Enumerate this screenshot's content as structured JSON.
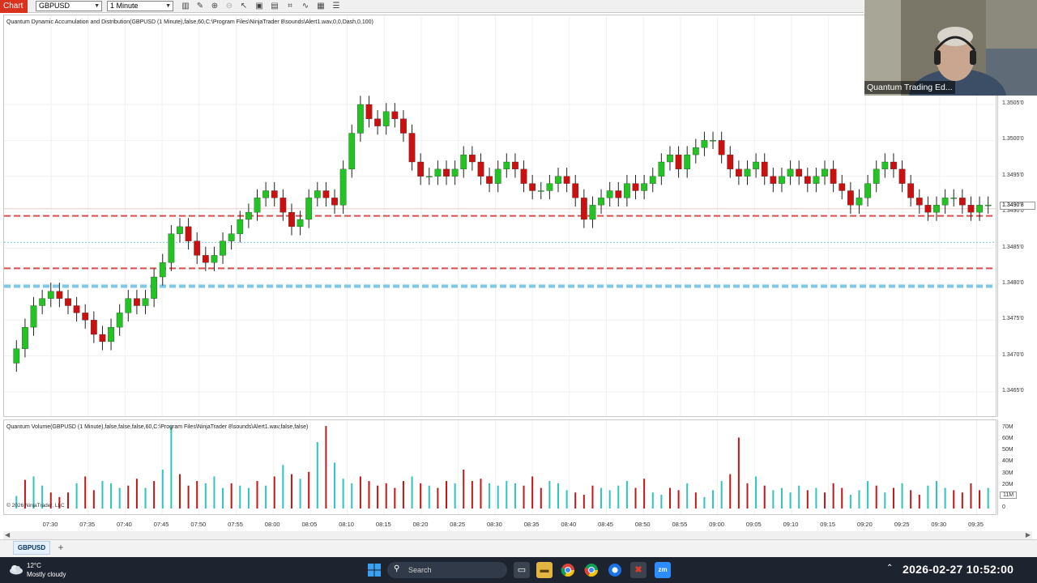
{
  "toolbar": {
    "tab_label": "Chart",
    "instrument": "GBPUSD",
    "interval": "1 Minute"
  },
  "price_pane": {
    "indicator_label": "Quantum Dynamic Accumulation and Distribution(GBPUSD (1 Minute),false,60,C:\\Program Files\\NinjaTrader 8\\sounds\\Alert1.wav,0,0,Dash,0,100)",
    "axis_ticks": [
      "1.3505'0",
      "1.3500'0",
      "1.3495'0",
      "1.3490'0",
      "1.3485'0",
      "1.3480'0",
      "1.3475'0",
      "1.3470'0",
      "1.3465'0"
    ],
    "last_price_tag": "1.3490'8"
  },
  "volume_pane": {
    "indicator_label": "Quantum Volume(GBPUSD (1 Minute),false,false,false,60,C:\\Program Files\\NinjaTrader 8\\sounds\\Alert1.wav,false,false)",
    "axis_ticks": [
      "70M",
      "60M",
      "50M",
      "40M",
      "30M",
      "20M",
      "11M",
      "0"
    ],
    "copyright": "© 2026 NinjaTrader, LLC"
  },
  "time_axis": [
    "07:30",
    "07:35",
    "07:40",
    "07:45",
    "07:50",
    "07:55",
    "08:00",
    "08:05",
    "08:10",
    "08:15",
    "08:20",
    "08:25",
    "08:30",
    "08:35",
    "08:40",
    "08:45",
    "08:50",
    "08:55",
    "09:00",
    "09:05",
    "09:10",
    "09:15",
    "09:20",
    "09:25",
    "09:30",
    "09:35"
  ],
  "instrument_tabs": {
    "active": "GBPUSD",
    "add": "+"
  },
  "webcam": {
    "name": "Quantum Trading Ed..."
  },
  "taskbar": {
    "weather_temp": "12°C",
    "weather_desc": "Mostly cloudy",
    "search_placeholder": "Search",
    "clock": "2026-02-27  10:52:00"
  },
  "colors": {
    "bull": "#22c322",
    "bear": "#cc1010",
    "volume_up": "#2ec4c0",
    "volume_down": "#c01818",
    "level_red": "#e04a4a",
    "level_blue": "#7cc9ea"
  },
  "chart_data": {
    "type": "candlestick",
    "title": "",
    "x_labels": [
      "07:30",
      "07:35",
      "07:40",
      "07:45",
      "07:50",
      "07:55",
      "08:00",
      "08:05",
      "08:10",
      "08:15",
      "08:20",
      "08:25",
      "08:30",
      "08:35",
      "08:40",
      "08:45",
      "08:50",
      "08:55",
      "09:00",
      "09:05",
      "09:10",
      "09:15",
      "09:20",
      "09:25",
      "09:30",
      "09:35"
    ],
    "y_unit": "price",
    "ylim": [
      1.3463,
      1.3508
    ],
    "price_levels": [
      {
        "price": 1.34895,
        "style": "dashed",
        "color": "red"
      },
      {
        "price": 1.34822,
        "style": "dashed",
        "color": "red"
      },
      {
        "price": 1.34797,
        "style": "dashed",
        "color": "blue"
      }
    ],
    "candle_closes": [
      1.3471,
      1.3474,
      1.3477,
      1.3478,
      1.3479,
      1.3478,
      1.3477,
      1.3476,
      1.3475,
      1.3473,
      1.3472,
      1.3474,
      1.3476,
      1.3478,
      1.3477,
      1.3478,
      1.3481,
      1.3483,
      1.3487,
      1.3488,
      1.3486,
      1.3484,
      1.3483,
      1.3484,
      1.3486,
      1.3487,
      1.3489,
      1.349,
      1.3492,
      1.3493,
      1.3492,
      1.349,
      1.3488,
      1.3489,
      1.3492,
      1.3493,
      1.3492,
      1.3491,
      1.3496,
      1.3501,
      1.3505,
      1.3503,
      1.3502,
      1.3504,
      1.3503,
      1.3501,
      1.3497,
      1.3495,
      1.3495,
      1.3496,
      1.3495,
      1.3496,
      1.3498,
      1.3497,
      1.3495,
      1.3494,
      1.3496,
      1.3497,
      1.3496,
      1.3494,
      1.3493,
      1.3493,
      1.3494,
      1.3495,
      1.3494,
      1.3492,
      1.3489,
      1.3491,
      1.3492,
      1.3493,
      1.3492,
      1.3494,
      1.3493,
      1.3494,
      1.3495,
      1.3497,
      1.3498,
      1.3496,
      1.3498,
      1.3499,
      1.35,
      1.35,
      1.3498,
      1.3496,
      1.3495,
      1.3496,
      1.3497,
      1.3495,
      1.3494,
      1.3495,
      1.3496,
      1.3495,
      1.3494,
      1.3495,
      1.3496,
      1.3494,
      1.3493,
      1.3491,
      1.3492,
      1.3494,
      1.3496,
      1.3497,
      1.3496,
      1.3494,
      1.3492,
      1.3491,
      1.349,
      1.3491,
      1.3492,
      1.3492,
      1.3491,
      1.349,
      1.3491,
      1.3491
    ],
    "volume_unit": "M",
    "volume_values": [
      11,
      25,
      28,
      20,
      14,
      10,
      14,
      22,
      28,
      16,
      24,
      22,
      18,
      20,
      26,
      18,
      24,
      34,
      72,
      30,
      20,
      24,
      22,
      28,
      18,
      22,
      20,
      18,
      24,
      20,
      28,
      38,
      30,
      26,
      32,
      58,
      72,
      40,
      26,
      22,
      28,
      24,
      20,
      22,
      18,
      24,
      28,
      22,
      20,
      18,
      24,
      22,
      34,
      24,
      26,
      22,
      20,
      24,
      22,
      20,
      28,
      18,
      24,
      22,
      16,
      14,
      12,
      20,
      18,
      16,
      20,
      24,
      18,
      26,
      14,
      12,
      18,
      16,
      22,
      14,
      10,
      16,
      24,
      30,
      62,
      22,
      28,
      20,
      16,
      18,
      14,
      20,
      16,
      18,
      14,
      22,
      18,
      12,
      16,
      24,
      20,
      14,
      18,
      22,
      16,
      12,
      20,
      24,
      18,
      16,
      14,
      22,
      16,
      18
    ]
  }
}
